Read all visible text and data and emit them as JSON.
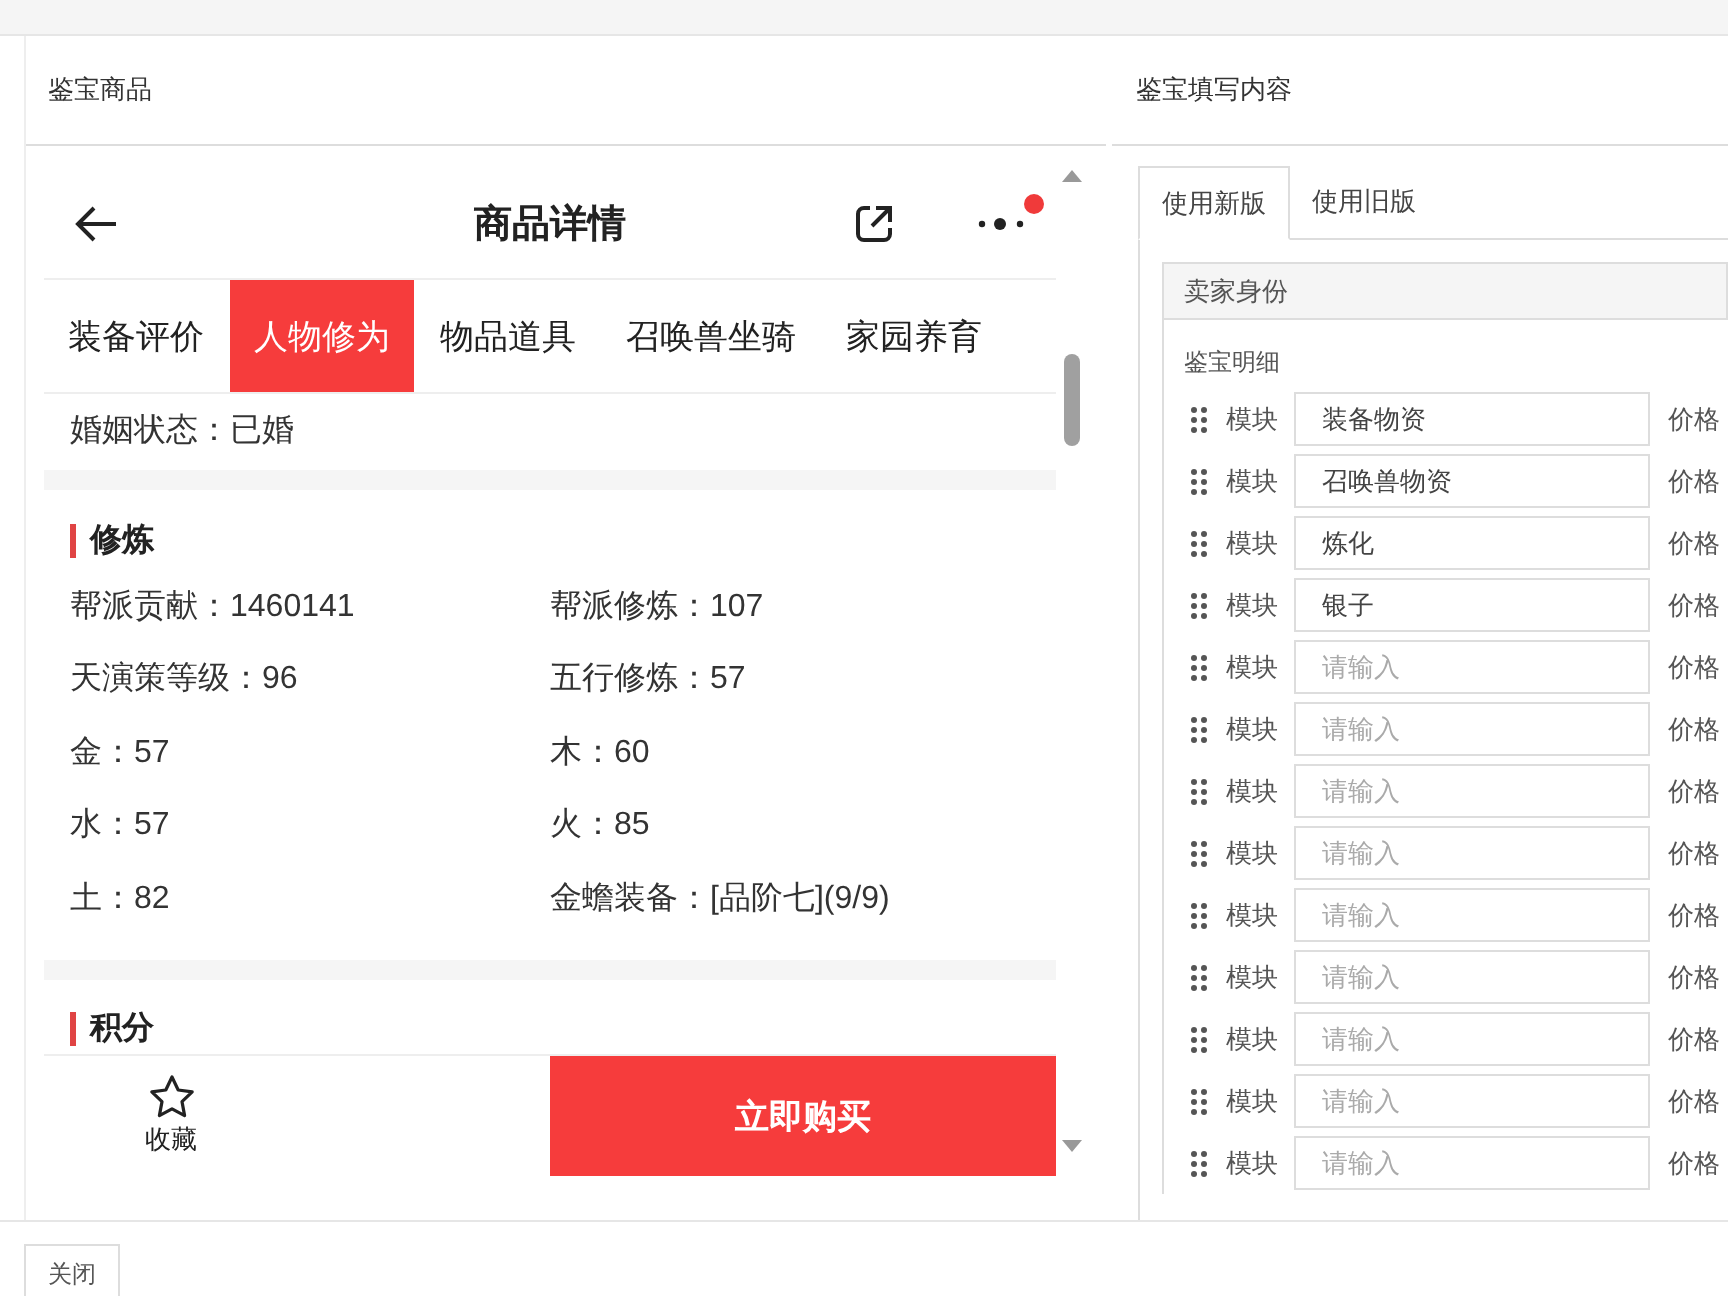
{
  "left_panel": {
    "title": "鉴宝商品"
  },
  "phone": {
    "title": "商品详情",
    "notification": true,
    "tabs": [
      {
        "label": "装备评价",
        "selected": false
      },
      {
        "label": "人物修为",
        "selected": true
      },
      {
        "label": "物品道具",
        "selected": false
      },
      {
        "label": "召唤兽坐骑",
        "selected": false
      },
      {
        "label": "家园养育",
        "selected": false
      }
    ],
    "marriage": "婚姻状态：已婚",
    "sections": [
      {
        "title": "修炼",
        "fields": [
          "帮派贡献：1460141",
          "帮派修炼：107",
          "天演策等级：96",
          "五行修炼：57",
          "金：57",
          "木：60",
          "水：57",
          "火：85",
          "土：82",
          "金蟾装备：[品阶七](9/9)"
        ]
      },
      {
        "title": "积分"
      }
    ],
    "favorite": "收藏",
    "buy": "立即购买"
  },
  "right_panel": {
    "title": "鉴宝填写内容",
    "tabs": [
      {
        "label": "使用新版",
        "selected": true
      },
      {
        "label": "使用旧版",
        "selected": false
      }
    ],
    "seller_section": "卖家身份",
    "detail_label": "鉴宝明细",
    "rows": [
      {
        "label": "模块",
        "value": "装备物资",
        "price_label": "价格"
      },
      {
        "label": "模块",
        "value": "召唤兽物资",
        "price_label": "价格"
      },
      {
        "label": "模块",
        "value": "炼化",
        "price_label": "价格"
      },
      {
        "label": "模块",
        "value": "银子",
        "price_label": "价格"
      },
      {
        "label": "模块",
        "placeholder": "请输入",
        "price_label": "价格"
      },
      {
        "label": "模块",
        "placeholder": "请输入",
        "price_label": "价格"
      },
      {
        "label": "模块",
        "placeholder": "请输入",
        "price_label": "价格"
      },
      {
        "label": "模块",
        "placeholder": "请输入",
        "price_label": "价格"
      },
      {
        "label": "模块",
        "placeholder": "请输入",
        "price_label": "价格"
      },
      {
        "label": "模块",
        "placeholder": "请输入",
        "price_label": "价格"
      },
      {
        "label": "模块",
        "placeholder": "请输入",
        "price_label": "价格"
      },
      {
        "label": "模块",
        "placeholder": "请输入",
        "price_label": "价格"
      },
      {
        "label": "模块",
        "placeholder": "请输入",
        "price_label": "价格"
      }
    ]
  },
  "close_button": "关闭"
}
